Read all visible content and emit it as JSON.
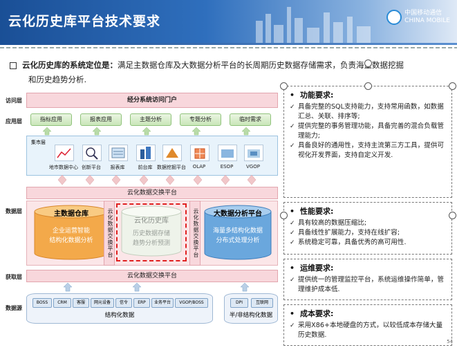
{
  "header": {
    "title": "云化历史库平台技术要求",
    "logo_cn": "中国移动通信",
    "logo_en": "CHINA MOBILE"
  },
  "intro": {
    "lead": "云化历史库的系统定位是：",
    "line1": "满足主数据仓库及大数据分析平台的长周期历史数据存储需求，负责海量数据挖掘",
    "line2": "和历史趋势分析."
  },
  "layers": {
    "access": "访问层",
    "app": "应用层",
    "data": "数据层",
    "acquire": "获取层",
    "source": "数据源"
  },
  "arch": {
    "portal": "经分系统访问门户",
    "apps": [
      "指标应用",
      "报表应用",
      "主题分析",
      "专题分析",
      "临时需求"
    ],
    "mart_label": "集市层",
    "tools": [
      "地市数据中心",
      "创新平台",
      "报表库",
      "前台库",
      "数据挖掘平台",
      "OLAP",
      "ESOP",
      "VGOP"
    ],
    "exchange_top": "云化数据交换平台",
    "exchange_bottom": "云化数据交换平台",
    "exchange_vertical": "云化数据交换平台",
    "main_dw": {
      "title": "主数据仓库",
      "desc1": "企业运营智能",
      "desc2": "结构化数据分析"
    },
    "cloud_hist": {
      "title": "云化历史库",
      "desc1": "历史数据存储",
      "desc2": "趋势分析预测"
    },
    "bigdata": {
      "title": "大数据分析平台",
      "desc1": "海量多结构化数据",
      "desc2": "分布式处理分析"
    },
    "sources_struct": [
      "BOSS",
      "CRM",
      "客服",
      "网元设备",
      "信令",
      "ERP",
      "业务平台",
      "VGOP/BOSS"
    ],
    "struct_label": "结构化数据",
    "sources_semi": [
      "DPI",
      "互联网"
    ],
    "semi_label": "半/非结构化数据"
  },
  "requirements": {
    "func": {
      "title": "功能要求:",
      "items": [
        "具备完整的SQL支持能力，支持常用函数，如数据汇总、关联、排序等;",
        "提供完整的事务管理功能，具备完善的混合负载管理能力;",
        "具备良好的通用性，支持主流第三方工具，提供可视化开发界面，支持自定义开发."
      ]
    },
    "perf": {
      "title": "性能要求:",
      "items": [
        "具有较高的数据压缩比;",
        "具备线性扩展能力，支持在线扩容;",
        "系统稳定可靠，具备优秀的高可用性."
      ]
    },
    "ops": {
      "title": "运维要求:",
      "items": [
        "提供统一的管理监控平台，系统运维操作简单，管理维护成本低."
      ]
    },
    "cost": {
      "title": "成本要求:",
      "items": [
        "采用X86+本地硬盘的方式，以较低成本存储大量历史数据."
      ]
    }
  },
  "page_number": "54",
  "colors": {
    "header": "#2f6fbd",
    "pink": "#f8d7dc",
    "green": "#c9e6b8",
    "orange": "#f3a94a",
    "blue": "#6aa7dd"
  }
}
